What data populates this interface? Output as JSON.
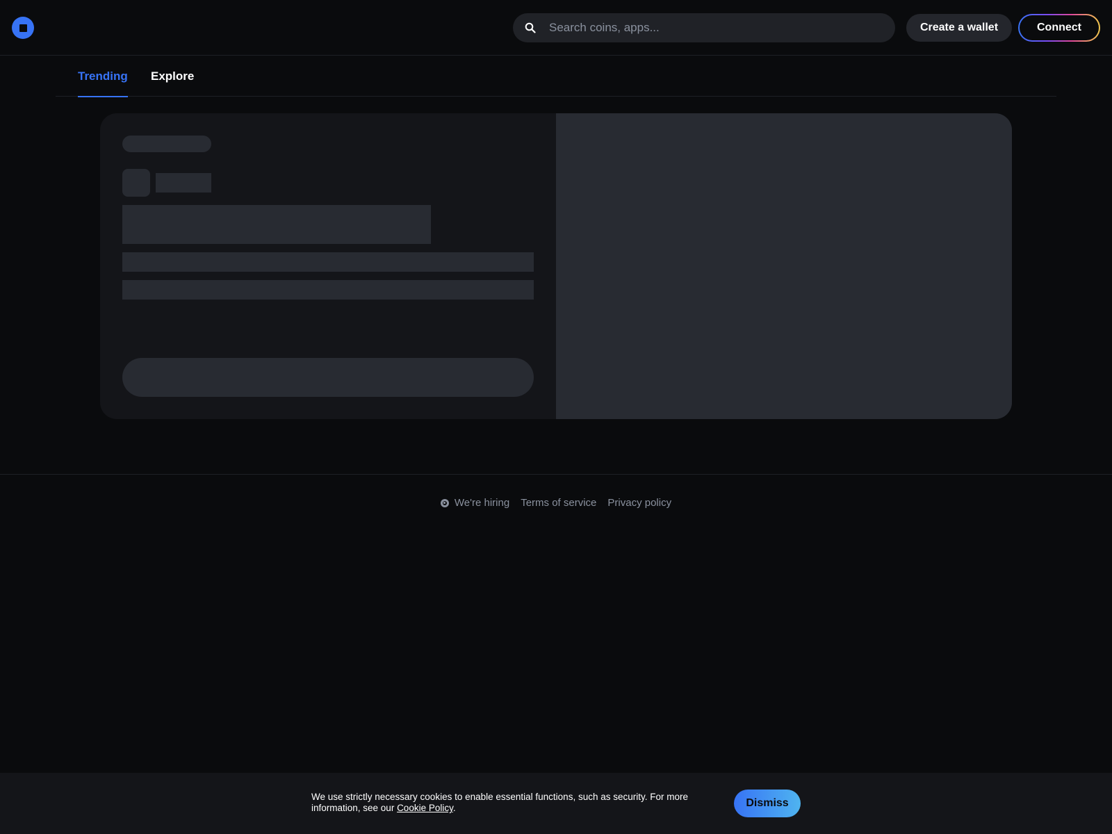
{
  "header": {
    "logo_icon": "coinbase-logo-icon",
    "search": {
      "icon": "search-icon",
      "placeholder": "Search coins, apps..."
    },
    "create_wallet_label": "Create a wallet",
    "connect_label": "Connect"
  },
  "tabs": [
    {
      "label": "Trending",
      "active": true
    },
    {
      "label": "Explore",
      "active": false
    }
  ],
  "main": {
    "state": "loading-skeleton"
  },
  "footer": {
    "links": [
      {
        "label": "We're hiring",
        "icon": "hiring-icon"
      },
      {
        "label": "Terms of service"
      },
      {
        "label": "Privacy policy"
      }
    ]
  },
  "cookie_banner": {
    "text": "We use strictly necessary cookies to enable essential functions, such as security. For more information, see our ",
    "link_label": "Cookie Policy",
    "text_end": ".",
    "dismiss_label": "Dismiss"
  },
  "colors": {
    "background": "#0a0b0d",
    "accent": "#3773f5",
    "skeleton": "#282b32",
    "card": "#141519",
    "muted_text": "#8a919e"
  }
}
